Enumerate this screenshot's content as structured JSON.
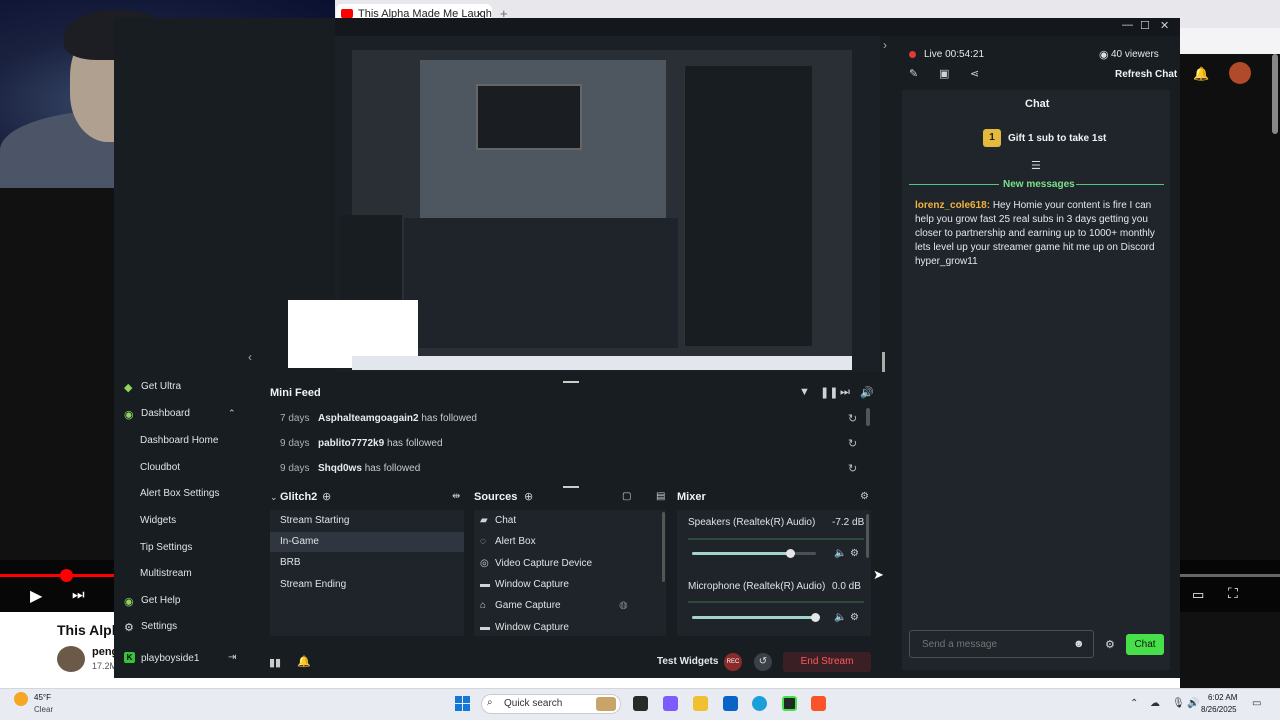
{
  "browser": {
    "tab_title": "This Alpha Made Me Laugh Ha",
    "tab_close": "×",
    "tab_plus": "+"
  },
  "youtube": {
    "video_title": "This Alph",
    "channel": "peng",
    "subs": "17.2M"
  },
  "window_controls": {
    "minimize": "—",
    "maximize": "☐",
    "close": "✕"
  },
  "sidebar": {
    "items": [
      {
        "label": "Get Ultra",
        "icon": "ultra-icon"
      },
      {
        "label": "Dashboard",
        "icon": "dashboard-icon"
      },
      {
        "label": "Dashboard Home"
      },
      {
        "label": "Cloudbot"
      },
      {
        "label": "Alert Box Settings"
      },
      {
        "label": "Widgets"
      },
      {
        "label": "Tip Settings"
      },
      {
        "label": "Multistream"
      },
      {
        "label": "Get Help",
        "icon": "help-icon"
      },
      {
        "label": "Settings",
        "icon": "gear-icon"
      }
    ],
    "user": "playboyside1",
    "logo_letter": "K"
  },
  "mini_feed": {
    "title": "Mini Feed",
    "rows": [
      {
        "time": "7 days",
        "name": "Asphalteamgoagain2",
        "action": "has followed"
      },
      {
        "time": "9 days",
        "name": "pablito7772k9",
        "action": "has followed"
      },
      {
        "time": "9 days",
        "name": "Shqd0ws",
        "action": "has followed"
      }
    ]
  },
  "scenes": {
    "title": "Glitch2",
    "items": [
      "Stream Starting",
      "In-Game",
      "BRB",
      "Stream Ending"
    ],
    "active": "In-Game"
  },
  "sources": {
    "title": "Sources",
    "items": [
      "Chat",
      "Alert Box",
      "Video Capture Device",
      "Window Capture",
      "Game Capture",
      "Window Capture"
    ]
  },
  "mixer": {
    "title": "Mixer",
    "channels": [
      {
        "name": "Speakers (Realtek(R) Audio)",
        "db": "-7.2 dB",
        "level": 0.8
      },
      {
        "name": "Microphone (Realtek(R) Audio)",
        "db": "0.0 dB",
        "level": 1.0
      }
    ]
  },
  "bottom_bar": {
    "test_widgets": "Test Widgets",
    "rec_label": "REC",
    "end_stream": "End Stream"
  },
  "chat": {
    "live_label": "Live 00:54:21",
    "viewers": "40 viewers",
    "refresh": "Refresh Chat",
    "title": "Chat",
    "gift_badge": "1",
    "gift_text": "Gift 1 sub to take 1st",
    "new_messages": "New messages",
    "message_user": "lorenz_cole618:",
    "message_text": " Hey Homie your content is fire I can help you grow fast 25 real subs in 3 days getting you closer to partnership and earning up to 1000+ monthly lets level up your streamer game hit me up on Discord hyper_grow11",
    "input_placeholder": "Send a message",
    "send_label": "Chat"
  },
  "taskbar": {
    "temp": "45°F",
    "weather": "Clear",
    "search_placeholder": "Quick search",
    "time": "6:02 AM",
    "date": "8/26/2025"
  },
  "colors": {
    "accent_green": "#48e04a",
    "live_red": "#e53935",
    "username_orange": "#f2b33d",
    "end_stream_red": "#ff5a5a"
  }
}
